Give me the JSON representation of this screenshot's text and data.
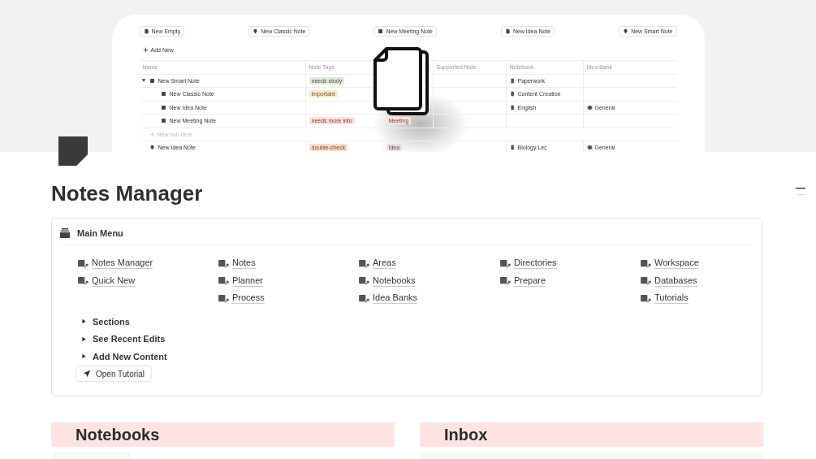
{
  "cover": {
    "kind": "screenshot",
    "buttons": [
      {
        "label": "New Empty"
      },
      {
        "label": "New Classic Note"
      },
      {
        "label": "New Meeting Note"
      },
      {
        "label": "New Idea Note"
      },
      {
        "label": "New Smart Note"
      }
    ],
    "add_new": "Add New",
    "table": {
      "columns": [
        {
          "label": "Name"
        },
        {
          "label": "Note Tags"
        },
        {},
        {
          "label": "Supported Note"
        },
        {
          "label": "Notebook"
        },
        {
          "label": "Idea Bank"
        }
      ],
      "rows": [
        {
          "kind": "item",
          "name": "New Smart Note",
          "expanded": true,
          "tag": {
            "label": "needs study",
            "color": "#dbeddb"
          },
          "notebook": "Paperwork",
          "children": [
            {
              "kind": "item",
              "name": "New Classic Note",
              "tag": {
                "label": "important",
                "color": "#fbecc8"
              },
              "notebook": "Content Creation"
            },
            {
              "kind": "item",
              "name": "New Idea Note",
              "notebook": "English",
              "idea_bank": "General"
            },
            {
              "kind": "item",
              "name": "New Meeting Note",
              "tag": {
                "label": "needs more info",
                "color": "#ffe2dd"
              },
              "column_3": {
                "label": "Meeting",
                "color": "#ffe2dd"
              }
            }
          ]
        },
        {
          "kind": "add",
          "name": "New sub-item"
        },
        {
          "kind": "item",
          "name": "New Idea Note",
          "tag": {
            "label": "double-check",
            "color": "#fadec9"
          },
          "column_3": {
            "label": "Idea",
            "color": "#e8deee"
          },
          "notebook": "Biology Lec",
          "idea_bank": "General"
        }
      ]
    }
  },
  "title": "Notes Manager",
  "main_menu": {
    "title": "Main Menu",
    "columns": [
      [
        {
          "label": "Notes Manager"
        },
        {
          "label": "Quick New"
        }
      ],
      [
        {
          "label": "Notes"
        },
        {
          "label": "Planner"
        },
        {
          "label": "Process"
        }
      ],
      [
        {
          "label": "Areas"
        },
        {
          "label": "Notebooks"
        },
        {
          "label": "Idea Banks"
        }
      ],
      [
        {
          "label": "Directories"
        },
        {
          "label": "Prepare"
        }
      ],
      [
        {
          "label": "Workspace"
        },
        {
          "label": "Databases"
        },
        {
          "label": "Tutorials"
        }
      ]
    ],
    "toggles": [
      {
        "label": "Sections",
        "expanded": false
      },
      {
        "label": "See Recent Edits",
        "expanded": false
      },
      {
        "label": "Add New Content",
        "expanded": false
      }
    ],
    "button": "Open Tutorial"
  },
  "sections": [
    {
      "kind": "gallery",
      "title": "Notebooks"
    },
    {
      "kind": "board",
      "title": "Inbox"
    }
  ]
}
